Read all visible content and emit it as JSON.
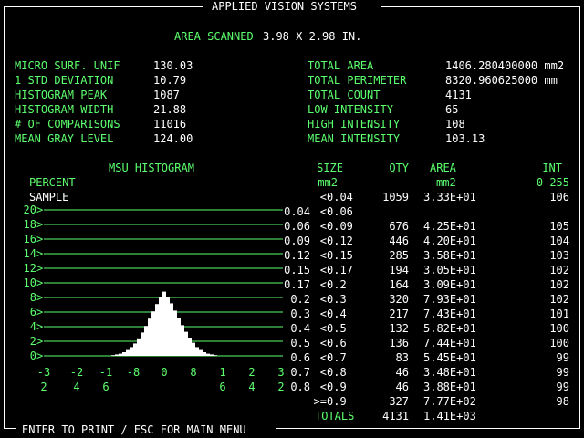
{
  "title": "APPLIED VISION SYSTEMS",
  "scan": {
    "label": "AREA SCANNED",
    "value": "3.98 X 2.98 IN."
  },
  "left_stats": [
    {
      "label": "MICRO SURF. UNIF",
      "value": "130.03"
    },
    {
      "label": "1 STD DEVIATION",
      "value": "10.79"
    },
    {
      "label": "HISTOGRAM PEAK",
      "value": "1087"
    },
    {
      "label": "HISTOGRAM WIDTH",
      "value": "21.88"
    },
    {
      "label": "# OF COMPARISONS",
      "value": "11016"
    },
    {
      "label": "MEAN GRAY LEVEL",
      "value": "124.00"
    }
  ],
  "right_stats": [
    {
      "label": "TOTAL AREA",
      "value": "1406.280400000 mm2"
    },
    {
      "label": "TOTAL PERIMETER",
      "value": "8320.960625000 mm"
    },
    {
      "label": "TOTAL COUNT",
      "value": "4131"
    },
    {
      "label": "LOW INTENSITY",
      "value": "65"
    },
    {
      "label": "HIGH INTENSITY",
      "value": "108"
    },
    {
      "label": "MEAN INTENSITY",
      "value": "103.13"
    }
  ],
  "histogram": {
    "title": "MSU HISTOGRAM",
    "ylabel1": "PERCENT",
    "ylabel2": "SAMPLE",
    "yticks": [
      "20",
      "18",
      "16",
      "14",
      "12",
      "10",
      "8",
      "6",
      "4",
      "2",
      "0"
    ],
    "xticks_row1": [
      "-3",
      "-2",
      "-1",
      "-8",
      "0",
      "8",
      "1",
      "2",
      "3"
    ],
    "xticks_row2": [
      "2",
      "4",
      "6",
      "",
      "",
      "",
      "6",
      "4",
      "2"
    ]
  },
  "chart_data": {
    "type": "bar",
    "title": "MSU HISTOGRAM",
    "ylabel": "PERCENT SAMPLE",
    "ylim": [
      0,
      20
    ],
    "x": [
      -14,
      -13,
      -12,
      -11,
      -10,
      -9,
      -8,
      -7,
      -6,
      -5,
      -4,
      -3,
      -2,
      -1,
      0,
      1,
      2,
      3,
      4,
      5,
      6,
      7,
      8,
      9,
      10,
      11,
      12,
      13,
      14
    ],
    "values": [
      0.1,
      0.2,
      0.3,
      0.5,
      0.8,
      1.2,
      1.7,
      2.4,
      3.2,
      4.1,
      5.1,
      6.1,
      7.1,
      8.0,
      8.8,
      8.1,
      7.2,
      6.2,
      5.2,
      4.2,
      3.3,
      2.5,
      1.8,
      1.2,
      0.8,
      0.5,
      0.3,
      0.2,
      0.1
    ]
  },
  "table": {
    "headers": {
      "size": "SIZE",
      "size_unit": "mm2",
      "qty": "QTY",
      "area": "AREA",
      "area_unit": "mm2",
      "int": "INT",
      "int_range": "0-255"
    },
    "rows": [
      {
        "lo": "",
        "op": "<",
        "hi": "0.04",
        "qty": "1059",
        "area": "3.33E+01",
        "int": "106"
      },
      {
        "lo": "0.04",
        "op": "<",
        "hi": "0.06",
        "qty": "",
        "area": "",
        "int": ""
      },
      {
        "lo": "0.06",
        "op": "<",
        "hi": "0.09",
        "qty": "676",
        "area": "4.25E+01",
        "int": "105"
      },
      {
        "lo": "0.09",
        "op": "<",
        "hi": "0.12",
        "qty": "446",
        "area": "4.20E+01",
        "int": "104"
      },
      {
        "lo": "0.12",
        "op": "<",
        "hi": "0.15",
        "qty": "285",
        "area": "3.58E+01",
        "int": "103"
      },
      {
        "lo": "0.15",
        "op": "<",
        "hi": "0.17",
        "qty": "194",
        "area": "3.05E+01",
        "int": "102"
      },
      {
        "lo": "0.17",
        "op": "<",
        "hi": "0.2",
        "qty": "164",
        "area": "3.09E+01",
        "int": "102"
      },
      {
        "lo": "0.2",
        "op": "<",
        "hi": "0.3",
        "qty": "320",
        "area": "7.93E+01",
        "int": "102"
      },
      {
        "lo": "0.3",
        "op": "<",
        "hi": "0.4",
        "qty": "217",
        "area": "7.43E+01",
        "int": "101"
      },
      {
        "lo": "0.4",
        "op": "<",
        "hi": "0.5",
        "qty": "132",
        "area": "5.82E+01",
        "int": "100"
      },
      {
        "lo": "0.5",
        "op": "<",
        "hi": "0.6",
        "qty": "136",
        "area": "7.44E+01",
        "int": "100"
      },
      {
        "lo": "0.6",
        "op": "<",
        "hi": "0.7",
        "qty": "83",
        "area": "5.45E+01",
        "int": "99"
      },
      {
        "lo": "0.7",
        "op": "<",
        "hi": "0.8",
        "qty": "46",
        "area": "3.48E+01",
        "int": "99"
      },
      {
        "lo": "0.8",
        "op": "<",
        "hi": "0.9",
        "qty": "46",
        "area": "3.88E+01",
        "int": "99"
      },
      {
        "lo": "",
        "op": ">=",
        "hi": "0.9",
        "qty": "327",
        "area": "7.77E+02",
        "int": "98"
      }
    ],
    "totals": {
      "label": "TOTALS",
      "qty": "4131",
      "area": "1.41E+03"
    }
  },
  "footer": "ENTER TO PRINT / ESC FOR MAIN MENU",
  "colors": {
    "label": "#5cff6e",
    "value": "#ffffff",
    "background": "#000000"
  }
}
